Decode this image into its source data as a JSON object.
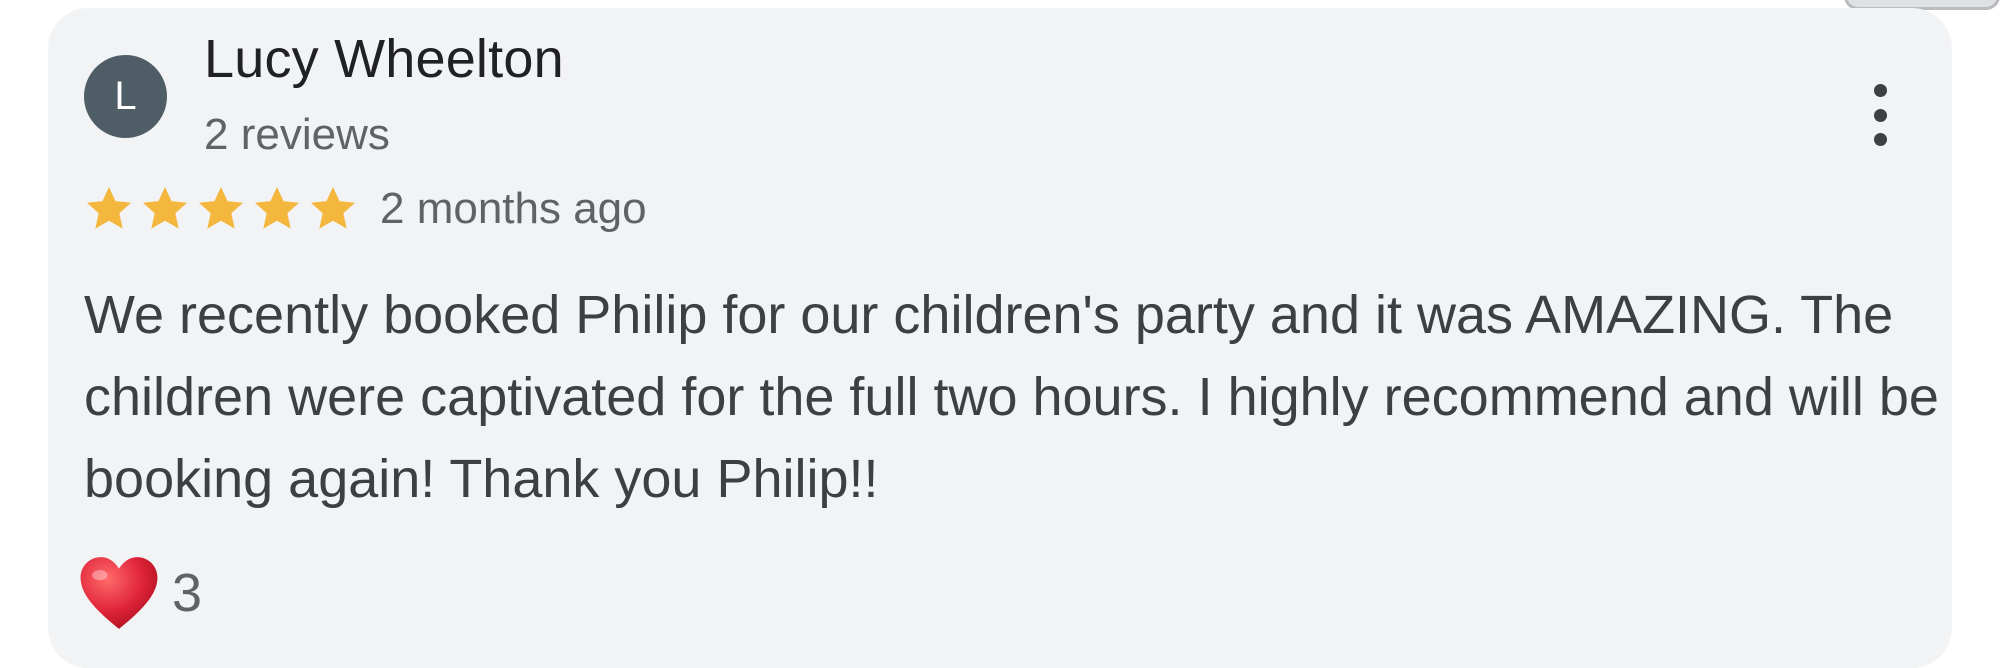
{
  "review": {
    "author_initial": "L",
    "author_name": "Lucy Wheelton",
    "review_count": "2 reviews",
    "rating": 5,
    "rating_max": 5,
    "time": "2 months ago",
    "text": "We recently booked Philip for our children's party and it was AMAZING. The children were captivated for the full two hours. I highly recommend and will be booking again! Thank you Philip!!",
    "reactions": {
      "icon": "heart-icon",
      "count": "3"
    }
  },
  "colors": {
    "star": "#f4b73e",
    "avatar": "#4f5d66",
    "heart": "#e0243a"
  }
}
